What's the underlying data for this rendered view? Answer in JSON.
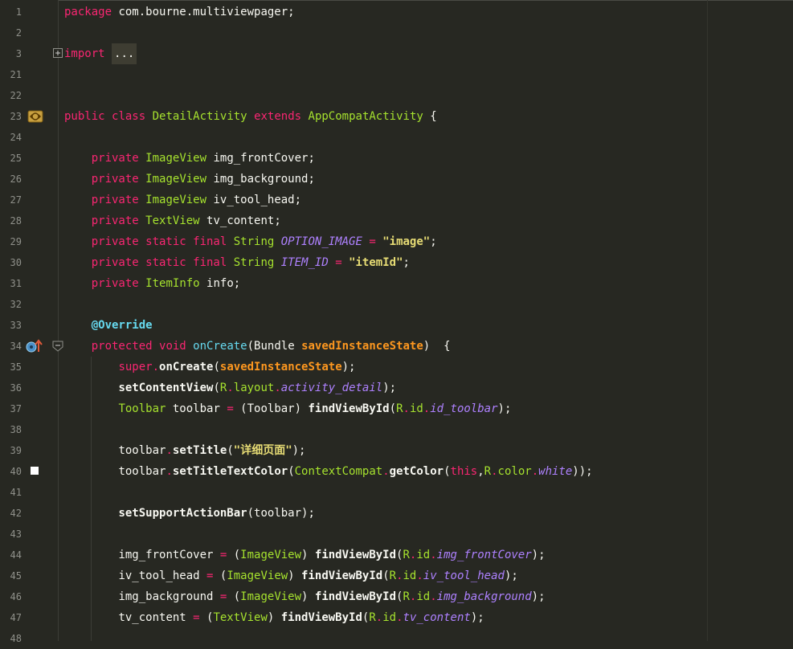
{
  "editor": {
    "language": "java",
    "colors": {
      "background": "#272822",
      "keyword": "#f92672",
      "type": "#a6e22e",
      "method": "#66d9ef",
      "parameter": "#fd971f",
      "string": "#e6db74",
      "constant": "#ae81ff",
      "plain": "#f8f8f2",
      "line_number": "#8f908a"
    },
    "gutter_icons": [
      {
        "line": "3",
        "icon": "fold-expand-icon"
      },
      {
        "line": "23",
        "icon": "class-implementation-icon"
      },
      {
        "line": "34",
        "icon": "override-method-icon"
      },
      {
        "line": "34",
        "icon": "fold-collapse-icon"
      },
      {
        "line": "40",
        "icon": "color-swatch-icon",
        "color": "#ffffff"
      }
    ]
  },
  "lines": [
    {
      "num": "1",
      "tokens": [
        {
          "t": "package",
          "c": "kw"
        },
        {
          "t": " com.bourne.multiviewpager;",
          "c": "pl"
        }
      ]
    },
    {
      "num": "2",
      "tokens": []
    },
    {
      "num": "3",
      "tokens": [
        {
          "t": "import",
          "c": "kw"
        },
        {
          "t": " ",
          "c": "pl"
        },
        {
          "t": "...",
          "c": "fold"
        }
      ]
    },
    {
      "num": "21",
      "tokens": []
    },
    {
      "num": "22",
      "tokens": []
    },
    {
      "num": "23",
      "tokens": [
        {
          "t": "public",
          "c": "kw"
        },
        {
          "t": " ",
          "c": "pl"
        },
        {
          "t": "class",
          "c": "kw"
        },
        {
          "t": " ",
          "c": "pl"
        },
        {
          "t": "DetailActivity",
          "c": "ty"
        },
        {
          "t": " ",
          "c": "pl"
        },
        {
          "t": "extends",
          "c": "kw"
        },
        {
          "t": " ",
          "c": "pl"
        },
        {
          "t": "AppCompatActivity",
          "c": "ty"
        },
        {
          "t": " {",
          "c": "pl"
        }
      ]
    },
    {
      "num": "24",
      "tokens": []
    },
    {
      "num": "25",
      "tokens": [
        {
          "t": "    ",
          "c": "pl"
        },
        {
          "t": "private",
          "c": "kw"
        },
        {
          "t": " ",
          "c": "pl"
        },
        {
          "t": "ImageView",
          "c": "ty"
        },
        {
          "t": " img_frontCover;",
          "c": "pl"
        }
      ]
    },
    {
      "num": "26",
      "tokens": [
        {
          "t": "    ",
          "c": "pl"
        },
        {
          "t": "private",
          "c": "kw"
        },
        {
          "t": " ",
          "c": "pl"
        },
        {
          "t": "ImageView",
          "c": "ty"
        },
        {
          "t": " img_background;",
          "c": "pl"
        }
      ]
    },
    {
      "num": "27",
      "tokens": [
        {
          "t": "    ",
          "c": "pl"
        },
        {
          "t": "private",
          "c": "kw"
        },
        {
          "t": " ",
          "c": "pl"
        },
        {
          "t": "ImageView",
          "c": "ty"
        },
        {
          "t": " iv_tool_head;",
          "c": "pl"
        }
      ]
    },
    {
      "num": "28",
      "tokens": [
        {
          "t": "    ",
          "c": "pl"
        },
        {
          "t": "private",
          "c": "kw"
        },
        {
          "t": " ",
          "c": "pl"
        },
        {
          "t": "TextView",
          "c": "ty"
        },
        {
          "t": " tv_content;",
          "c": "pl"
        }
      ]
    },
    {
      "num": "29",
      "tokens": [
        {
          "t": "    ",
          "c": "pl"
        },
        {
          "t": "private static final",
          "c": "kw"
        },
        {
          "t": " ",
          "c": "pl"
        },
        {
          "t": "String",
          "c": "ty"
        },
        {
          "t": " ",
          "c": "pl"
        },
        {
          "t": "OPTION_IMAGE",
          "c": "cn"
        },
        {
          "t": " ",
          "c": "pl"
        },
        {
          "t": "=",
          "c": "kw"
        },
        {
          "t": " ",
          "c": "pl"
        },
        {
          "t": "\"image\"",
          "c": "st"
        },
        {
          "t": ";",
          "c": "pl"
        }
      ]
    },
    {
      "num": "30",
      "tokens": [
        {
          "t": "    ",
          "c": "pl"
        },
        {
          "t": "private static final",
          "c": "kw"
        },
        {
          "t": " ",
          "c": "pl"
        },
        {
          "t": "String",
          "c": "ty"
        },
        {
          "t": " ",
          "c": "pl"
        },
        {
          "t": "ITEM_ID",
          "c": "cn"
        },
        {
          "t": " ",
          "c": "pl"
        },
        {
          "t": "=",
          "c": "kw"
        },
        {
          "t": " ",
          "c": "pl"
        },
        {
          "t": "\"itemId\"",
          "c": "st"
        },
        {
          "t": ";",
          "c": "pl"
        }
      ]
    },
    {
      "num": "31",
      "tokens": [
        {
          "t": "    ",
          "c": "pl"
        },
        {
          "t": "private",
          "c": "kw"
        },
        {
          "t": " ",
          "c": "pl"
        },
        {
          "t": "ItemInfo",
          "c": "ty"
        },
        {
          "t": " info;",
          "c": "pl"
        }
      ]
    },
    {
      "num": "32",
      "tokens": []
    },
    {
      "num": "33",
      "tokens": [
        {
          "t": "    ",
          "c": "pl"
        },
        {
          "t": "@Override",
          "c": "an"
        }
      ]
    },
    {
      "num": "34",
      "tokens": [
        {
          "t": "    ",
          "c": "pl"
        },
        {
          "t": "protected",
          "c": "kw"
        },
        {
          "t": " ",
          "c": "pl"
        },
        {
          "t": "void",
          "c": "kw"
        },
        {
          "t": " ",
          "c": "pl"
        },
        {
          "t": "onCreate",
          "c": "fn"
        },
        {
          "t": "(",
          "c": "pl"
        },
        {
          "t": "Bundle",
          "c": "pl"
        },
        {
          "t": " ",
          "c": "pl"
        },
        {
          "t": "savedInstanceState",
          "c": "pr"
        },
        {
          "t": ")  {",
          "c": "pl"
        }
      ]
    },
    {
      "num": "35",
      "tokens": [
        {
          "t": "        ",
          "c": "pl"
        },
        {
          "t": "super",
          "c": "kw"
        },
        {
          "t": ".",
          "c": "kw"
        },
        {
          "t": "onCreate",
          "c": "bd"
        },
        {
          "t": "(",
          "c": "pl"
        },
        {
          "t": "savedInstanceState",
          "c": "pr"
        },
        {
          "t": ");",
          "c": "pl"
        }
      ]
    },
    {
      "num": "36",
      "tokens": [
        {
          "t": "        ",
          "c": "pl"
        },
        {
          "t": "setContentView",
          "c": "bd"
        },
        {
          "t": "(",
          "c": "pl"
        },
        {
          "t": "R",
          "c": "ty"
        },
        {
          "t": ".",
          "c": "kw"
        },
        {
          "t": "layout",
          "c": "ty"
        },
        {
          "t": ".",
          "c": "kw"
        },
        {
          "t": "activity_detail",
          "c": "cn"
        },
        {
          "t": ");",
          "c": "pl"
        }
      ]
    },
    {
      "num": "37",
      "tokens": [
        {
          "t": "        ",
          "c": "pl"
        },
        {
          "t": "Toolbar",
          "c": "ty"
        },
        {
          "t": " toolbar ",
          "c": "pl"
        },
        {
          "t": "=",
          "c": "kw"
        },
        {
          "t": " (Toolbar) ",
          "c": "pl"
        },
        {
          "t": "findViewById",
          "c": "bd"
        },
        {
          "t": "(",
          "c": "pl"
        },
        {
          "t": "R",
          "c": "ty"
        },
        {
          "t": ".",
          "c": "kw"
        },
        {
          "t": "id",
          "c": "ty"
        },
        {
          "t": ".",
          "c": "kw"
        },
        {
          "t": "id_toolbar",
          "c": "cn"
        },
        {
          "t": ");",
          "c": "pl"
        }
      ]
    },
    {
      "num": "38",
      "tokens": []
    },
    {
      "num": "39",
      "tokens": [
        {
          "t": "        ",
          "c": "pl"
        },
        {
          "t": "toolbar",
          "c": "pl"
        },
        {
          "t": ".",
          "c": "kw"
        },
        {
          "t": "setTitle",
          "c": "bd"
        },
        {
          "t": "(",
          "c": "pl"
        },
        {
          "t": "\"详细页面\"",
          "c": "st"
        },
        {
          "t": ");",
          "c": "pl"
        }
      ]
    },
    {
      "num": "40",
      "tokens": [
        {
          "t": "        ",
          "c": "pl"
        },
        {
          "t": "toolbar",
          "c": "pl"
        },
        {
          "t": ".",
          "c": "kw"
        },
        {
          "t": "setTitleTextColor",
          "c": "bd"
        },
        {
          "t": "(",
          "c": "pl"
        },
        {
          "t": "ContextCompat",
          "c": "ty"
        },
        {
          "t": ".",
          "c": "kw"
        },
        {
          "t": "getColor",
          "c": "bd"
        },
        {
          "t": "(",
          "c": "pl"
        },
        {
          "t": "this",
          "c": "kw"
        },
        {
          "t": ",",
          "c": "pl"
        },
        {
          "t": "R",
          "c": "ty"
        },
        {
          "t": ".",
          "c": "kw"
        },
        {
          "t": "color",
          "c": "ty"
        },
        {
          "t": ".",
          "c": "kw"
        },
        {
          "t": "white",
          "c": "cn"
        },
        {
          "t": "));",
          "c": "pl"
        }
      ]
    },
    {
      "num": "41",
      "tokens": []
    },
    {
      "num": "42",
      "tokens": [
        {
          "t": "        ",
          "c": "pl"
        },
        {
          "t": "setSupportActionBar",
          "c": "bd"
        },
        {
          "t": "(toolbar);",
          "c": "pl"
        }
      ]
    },
    {
      "num": "43",
      "tokens": []
    },
    {
      "num": "44",
      "tokens": [
        {
          "t": "        ",
          "c": "pl"
        },
        {
          "t": "img_frontCover ",
          "c": "pl"
        },
        {
          "t": "=",
          "c": "kw"
        },
        {
          "t": " (",
          "c": "pl"
        },
        {
          "t": "ImageView",
          "c": "ty"
        },
        {
          "t": ") ",
          "c": "pl"
        },
        {
          "t": "findViewById",
          "c": "bd"
        },
        {
          "t": "(",
          "c": "pl"
        },
        {
          "t": "R",
          "c": "ty"
        },
        {
          "t": ".",
          "c": "kw"
        },
        {
          "t": "id",
          "c": "ty"
        },
        {
          "t": ".",
          "c": "kw"
        },
        {
          "t": "img_frontCover",
          "c": "cn"
        },
        {
          "t": ");",
          "c": "pl"
        }
      ]
    },
    {
      "num": "45",
      "tokens": [
        {
          "t": "        ",
          "c": "pl"
        },
        {
          "t": "iv_tool_head ",
          "c": "pl"
        },
        {
          "t": "=",
          "c": "kw"
        },
        {
          "t": " (",
          "c": "pl"
        },
        {
          "t": "ImageView",
          "c": "ty"
        },
        {
          "t": ") ",
          "c": "pl"
        },
        {
          "t": "findViewById",
          "c": "bd"
        },
        {
          "t": "(",
          "c": "pl"
        },
        {
          "t": "R",
          "c": "ty"
        },
        {
          "t": ".",
          "c": "kw"
        },
        {
          "t": "id",
          "c": "ty"
        },
        {
          "t": ".",
          "c": "kw"
        },
        {
          "t": "iv_tool_head",
          "c": "cn"
        },
        {
          "t": ");",
          "c": "pl"
        }
      ]
    },
    {
      "num": "46",
      "tokens": [
        {
          "t": "        ",
          "c": "pl"
        },
        {
          "t": "img_background ",
          "c": "pl"
        },
        {
          "t": "=",
          "c": "kw"
        },
        {
          "t": " (",
          "c": "pl"
        },
        {
          "t": "ImageView",
          "c": "ty"
        },
        {
          "t": ") ",
          "c": "pl"
        },
        {
          "t": "findViewById",
          "c": "bd"
        },
        {
          "t": "(",
          "c": "pl"
        },
        {
          "t": "R",
          "c": "ty"
        },
        {
          "t": ".",
          "c": "kw"
        },
        {
          "t": "id",
          "c": "ty"
        },
        {
          "t": ".",
          "c": "kw"
        },
        {
          "t": "img_background",
          "c": "cn"
        },
        {
          "t": ");",
          "c": "pl"
        }
      ]
    },
    {
      "num": "47",
      "tokens": [
        {
          "t": "        ",
          "c": "pl"
        },
        {
          "t": "tv_content ",
          "c": "pl"
        },
        {
          "t": "=",
          "c": "kw"
        },
        {
          "t": " (",
          "c": "pl"
        },
        {
          "t": "TextView",
          "c": "ty"
        },
        {
          "t": ") ",
          "c": "pl"
        },
        {
          "t": "findViewById",
          "c": "bd"
        },
        {
          "t": "(",
          "c": "pl"
        },
        {
          "t": "R",
          "c": "ty"
        },
        {
          "t": ".",
          "c": "kw"
        },
        {
          "t": "id",
          "c": "ty"
        },
        {
          "t": ".",
          "c": "kw"
        },
        {
          "t": "tv_content",
          "c": "cn"
        },
        {
          "t": ");",
          "c": "pl"
        }
      ]
    },
    {
      "num": "48",
      "tokens": []
    }
  ]
}
